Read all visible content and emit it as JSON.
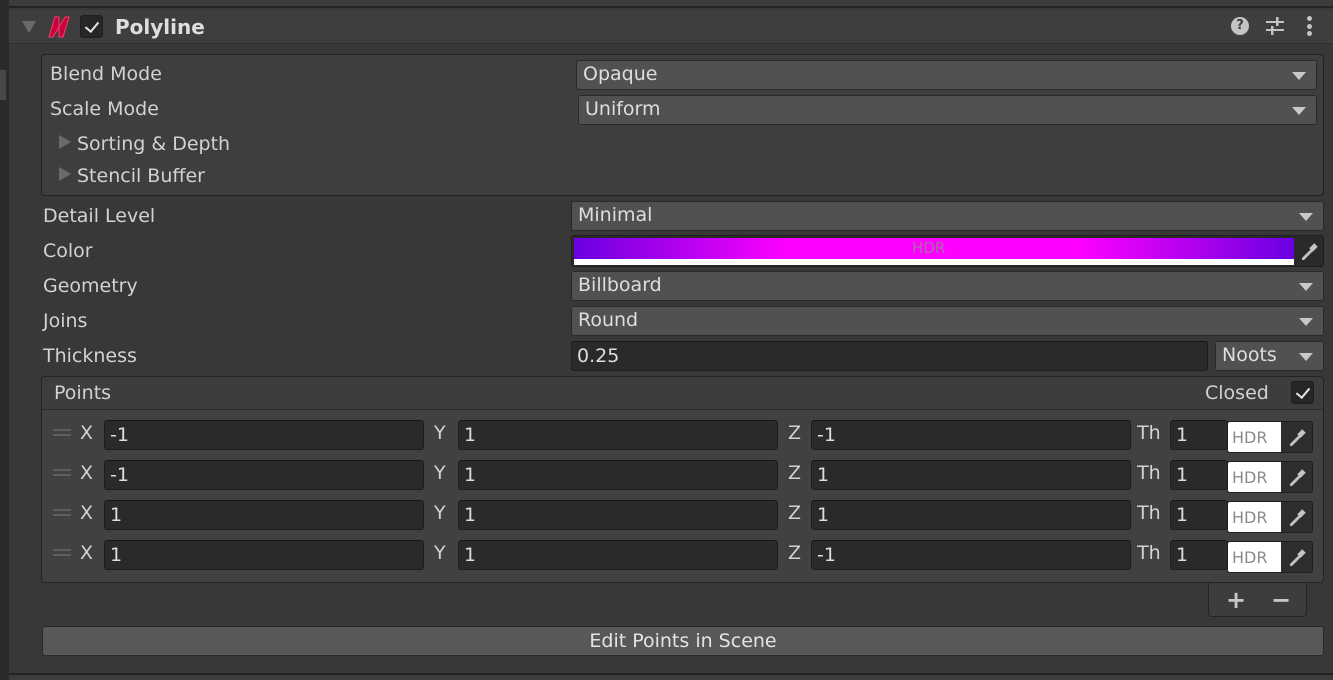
{
  "component": {
    "title": "Polyline",
    "enabled": true,
    "icon": "shapes-polyline-icon",
    "header_icons": [
      "help-icon",
      "presets-icon",
      "kebab-menu-icon"
    ]
  },
  "rendering": {
    "blend_mode": {
      "label": "Blend Mode",
      "value": "Opaque"
    },
    "scale_mode": {
      "label": "Scale Mode",
      "value": "Uniform"
    },
    "foldouts": [
      "Sorting & Depth",
      "Stencil Buffer"
    ]
  },
  "properties": {
    "detail_level": {
      "label": "Detail Level",
      "value": "Minimal"
    },
    "color": {
      "label": "Color",
      "hdr_label": "HDR",
      "gradient": [
        "#6a00e0",
        "#ff00ff",
        "#ff00ff",
        "#6a00e0"
      ],
      "alpha": 1.0
    },
    "geometry": {
      "label": "Geometry",
      "value": "Billboard"
    },
    "joins": {
      "label": "Joins",
      "value": "Round"
    },
    "thickness": {
      "label": "Thickness",
      "value": "0.25",
      "unit": "Noots"
    }
  },
  "points": {
    "label": "Points",
    "closed_label": "Closed",
    "closed": true,
    "axis_labels": {
      "x": "X",
      "y": "Y",
      "z": "Z",
      "th": "Th"
    },
    "hdr_label": "HDR",
    "rows": [
      {
        "x": "-1",
        "y": "1",
        "z": "-1",
        "th": "1"
      },
      {
        "x": "-1",
        "y": "1",
        "z": "1",
        "th": "1"
      },
      {
        "x": "1",
        "y": "1",
        "z": "1",
        "th": "1"
      },
      {
        "x": "1",
        "y": "1",
        "z": "-1",
        "th": "1"
      }
    ],
    "add_label": "+",
    "remove_label": "−"
  },
  "edit_button_label": "Edit Points in Scene"
}
